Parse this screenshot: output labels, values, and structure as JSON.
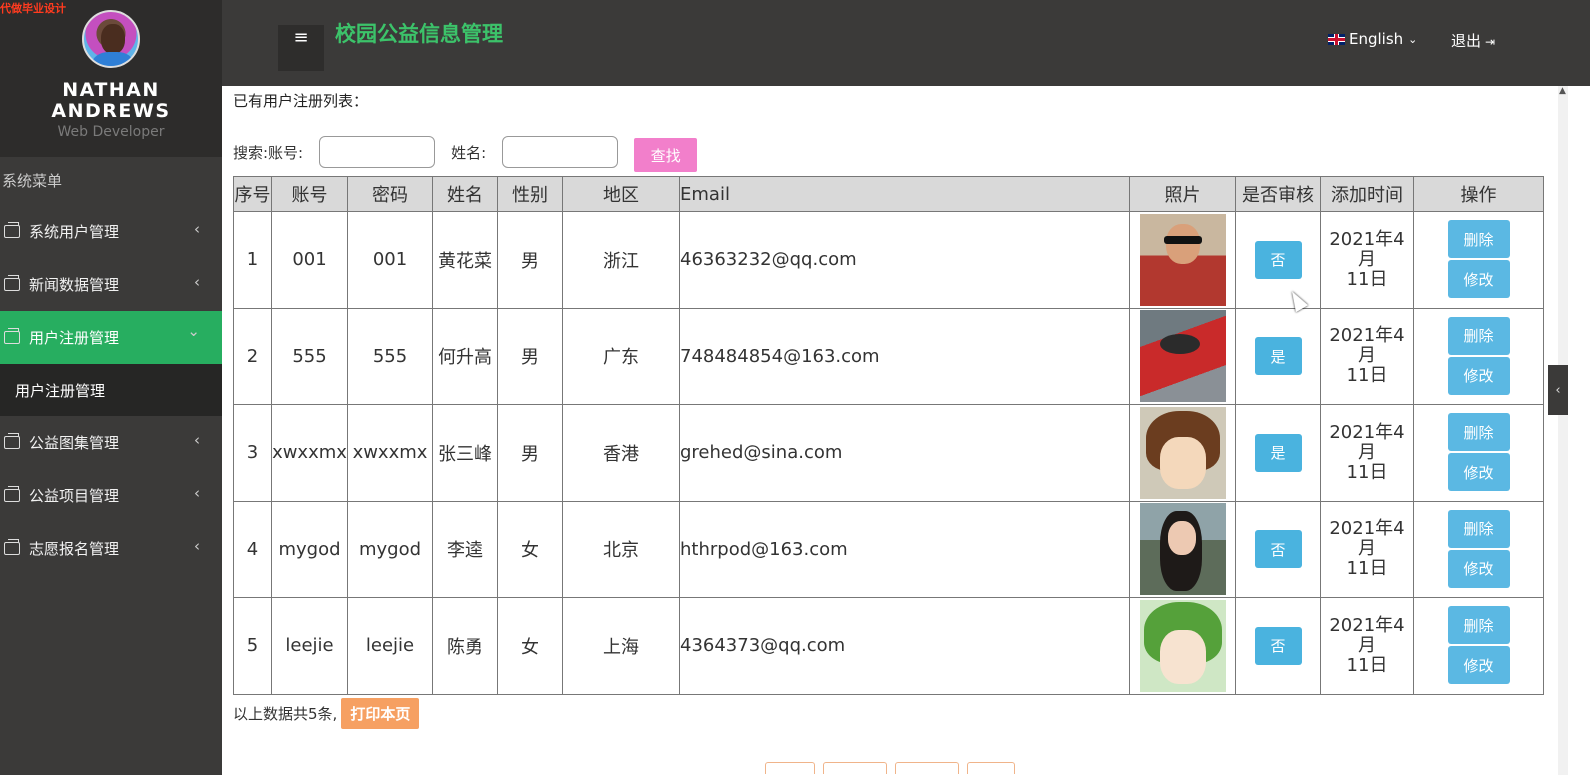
{
  "watermark": "代做毕业设计",
  "profile": {
    "name": "NATHAN ANDREWS",
    "role": "Web Developer"
  },
  "sidebar": {
    "menu_title": "系统菜单",
    "items": [
      {
        "label": "系统用户管理",
        "chev": "‹"
      },
      {
        "label": "新闻数据管理",
        "chev": "‹"
      },
      {
        "label": "用户注册管理",
        "chev": "⌄"
      },
      {
        "label": "公益图集管理",
        "chev": "‹"
      },
      {
        "label": "公益项目管理",
        "chev": "‹"
      },
      {
        "label": "志愿报名管理",
        "chev": "‹"
      }
    ],
    "sub_items": [
      {
        "label": "用户注册管理"
      }
    ]
  },
  "header": {
    "menu_icon": "≡",
    "title": "校园公益信息管理",
    "language": "English",
    "logout": "退出"
  },
  "content": {
    "list_title": "已有用户注册列表：",
    "search": {
      "account_label": "搜索:账号:",
      "name_label": "姓名:",
      "button": "查找"
    },
    "table": {
      "headers": [
        "序号",
        "账号",
        "密码",
        "姓名",
        "性别",
        "地区",
        "Email",
        "照片",
        "是否审核",
        "添加时间",
        "操作"
      ],
      "rows": [
        {
          "no": "1",
          "account": "001",
          "password": "001",
          "name": "黄花菜",
          "gender": "男",
          "region": "浙江",
          "email": "46363232@qq.com",
          "photo": "user-photo-1",
          "audit": "否",
          "date1": "2021年4月",
          "date2": "11日"
        },
        {
          "no": "2",
          "account": "555",
          "password": "555",
          "name": "何升高",
          "gender": "男",
          "region": "广东",
          "email": "748484854@163.com",
          "photo": "user-photo-2",
          "audit": "是",
          "date1": "2021年4月",
          "date2": "11日"
        },
        {
          "no": "3",
          "account": "xwxxmx",
          "password": "xwxxmx",
          "name": "张三峰",
          "gender": "男",
          "region": "香港",
          "email": "grehed@sina.com",
          "photo": "user-photo-3",
          "audit": "是",
          "date1": "2021年4月",
          "date2": "11日"
        },
        {
          "no": "4",
          "account": "mygod",
          "password": "mygod",
          "name": "李逵",
          "gender": "女",
          "region": "北京",
          "email": "hthrpod@163.com",
          "photo": "user-photo-4",
          "audit": "否",
          "date1": "2021年4月",
          "date2": "11日"
        },
        {
          "no": "5",
          "account": "leejie",
          "password": "leejie",
          "name": "陈勇",
          "gender": "女",
          "region": "上海",
          "email": "4364373@qq.com",
          "photo": "user-photo-5",
          "audit": "否",
          "date1": "2021年4月",
          "date2": "11日"
        }
      ],
      "delete_label": "删除",
      "edit_label": "修改"
    },
    "summary": "以上数据共5条,",
    "print_button": "打印本页"
  },
  "colors": {
    "sidebar_bg": "#3b3a39",
    "accent_green": "#27ae60",
    "title_green": "#3cc36a",
    "search_button": "#f27fcb",
    "action_blue": "#4ab3df",
    "print_orange": "#f6a062"
  }
}
